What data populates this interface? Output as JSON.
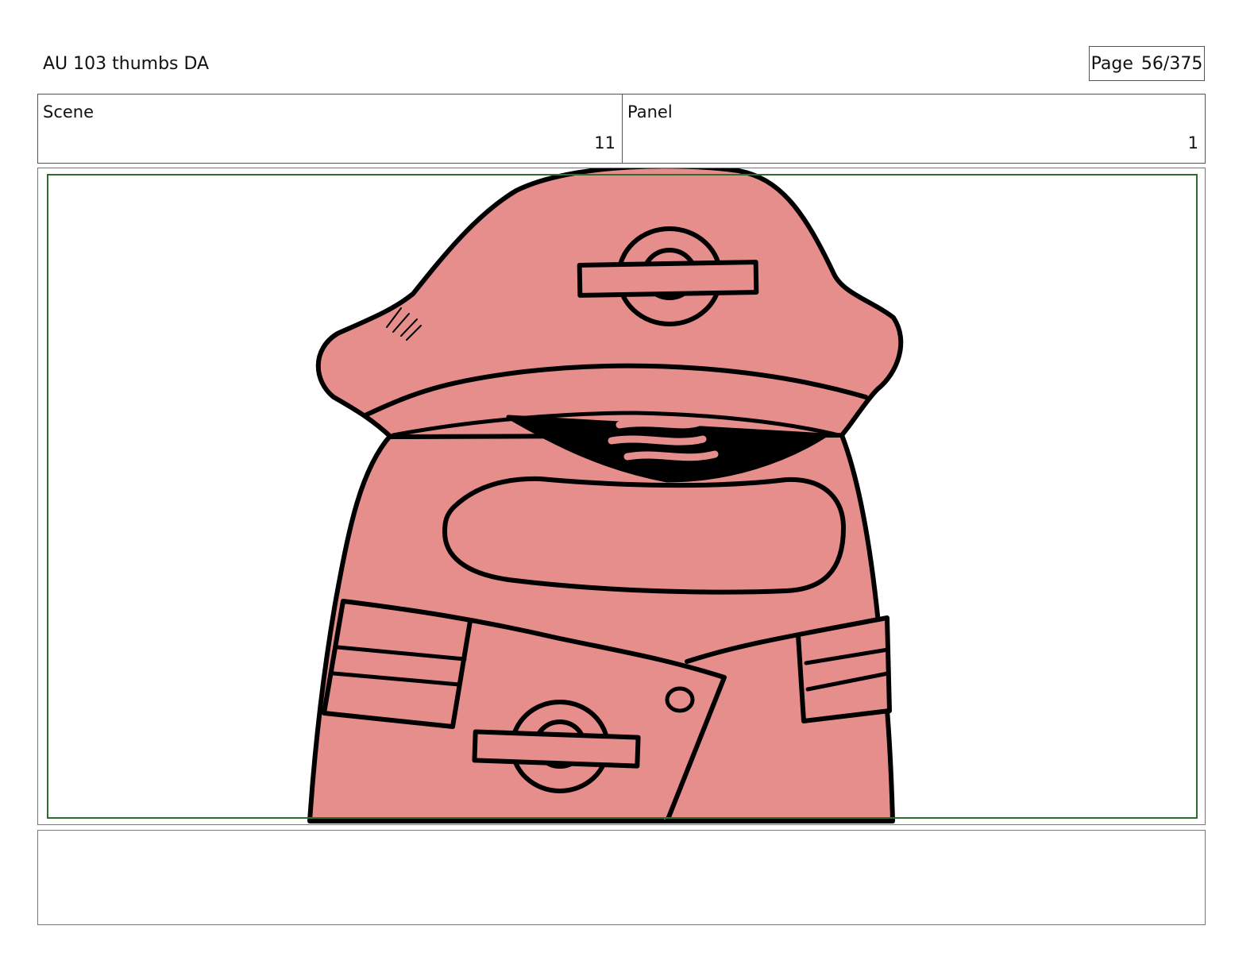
{
  "header": {
    "title": "AU 103 thumbs DA",
    "page_label": "Page",
    "page_number": "56/375"
  },
  "info": {
    "scene_label": "Scene",
    "scene_value": "11",
    "panel_label": "Panel",
    "panel_value": "1"
  },
  "frame": {
    "character_fill": "#e58e8c",
    "outline_color": "#000000",
    "safe_frame_color": "#2e6b2e"
  },
  "notes": {
    "text": ""
  }
}
